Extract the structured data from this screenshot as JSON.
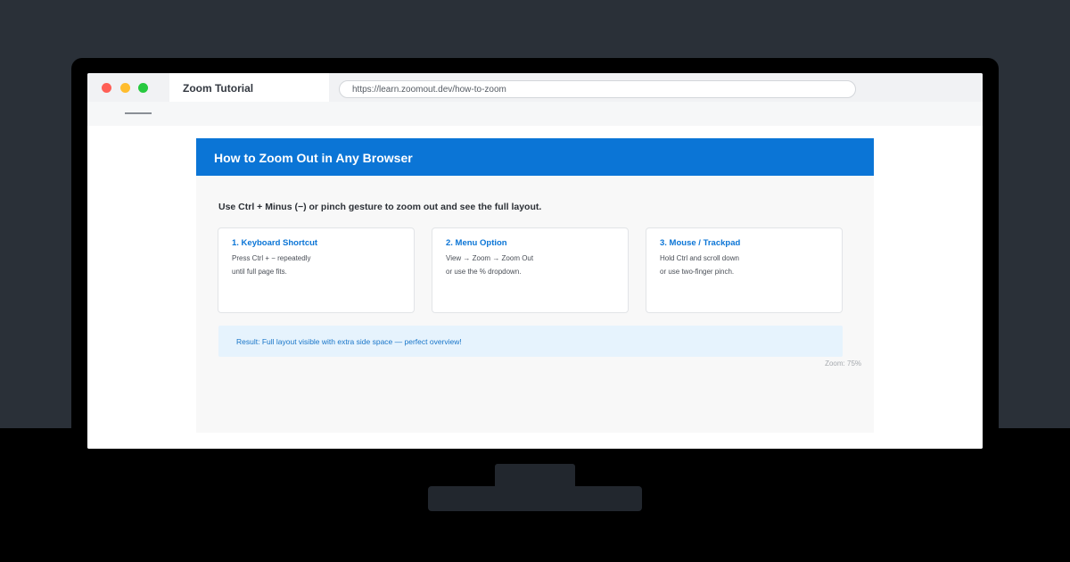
{
  "browser": {
    "tab_title": "Zoom Tutorial",
    "url": "https://learn.zoomout.dev/how-to-zoom"
  },
  "page": {
    "title": "How to Zoom Out in Any Browser",
    "intro": "Use Ctrl + Minus (−) or pinch gesture to zoom out and see the full layout.",
    "cards": [
      {
        "title": "1. Keyboard Shortcut",
        "line1": "Press Ctrl + − repeatedly",
        "line2": "until full page fits."
      },
      {
        "title": "2. Menu Option",
        "line1": "View → Zoom → Zoom Out",
        "line2": "or use the % dropdown."
      },
      {
        "title": "3. Mouse / Trackpad",
        "line1": "Hold Ctrl and scroll down",
        "line2": "or use two-finger pinch."
      }
    ],
    "result": "Result: Full layout visible with extra side space — perfect overview!",
    "zoom_label": "Zoom: 75%"
  },
  "colors": {
    "accent": "#0b75d6",
    "background": "#2a3038",
    "result_bg": "#e6f3fd",
    "close": "#ff5f56",
    "minimize": "#ffbd2e",
    "maximize": "#27c93f"
  }
}
